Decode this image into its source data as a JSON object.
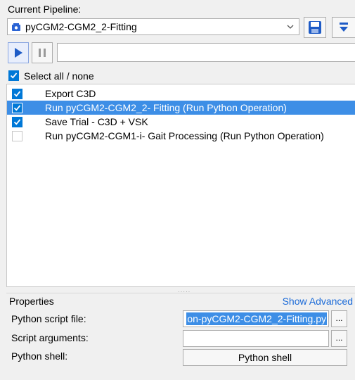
{
  "header": {
    "current_pipeline_label": "Current Pipeline:",
    "pipeline_name": "pyCGM2-CGM2_2-Fitting"
  },
  "select_all_label": "Select all / none",
  "operations": [
    {
      "label": "Export C3D",
      "checked": true,
      "selected": false
    },
    {
      "label": "Run pyCGM2-CGM2_2- Fitting  (Run Python Operation)",
      "checked": true,
      "selected": true
    },
    {
      "label": "Save Trial - C3D + VSK",
      "checked": true,
      "selected": false
    },
    {
      "label": "Run pyCGM2-CGM1-i- Gait Processing  (Run Python Operation)",
      "checked": false,
      "selected": false
    }
  ],
  "properties": {
    "title": "Properties",
    "show_advanced": "Show Advanced",
    "script_file_label": "Python script file:",
    "script_file_value": "on-pyCGM2-CGM2_2-Fitting.py",
    "script_args_label": "Script arguments:",
    "script_args_value": "",
    "python_shell_label": "Python shell:",
    "python_shell_button": "Python shell",
    "browse_label": "..."
  },
  "colors": {
    "selection": "#3d8ee6",
    "checkbox": "#0078d7",
    "link": "#1a6ad8"
  }
}
